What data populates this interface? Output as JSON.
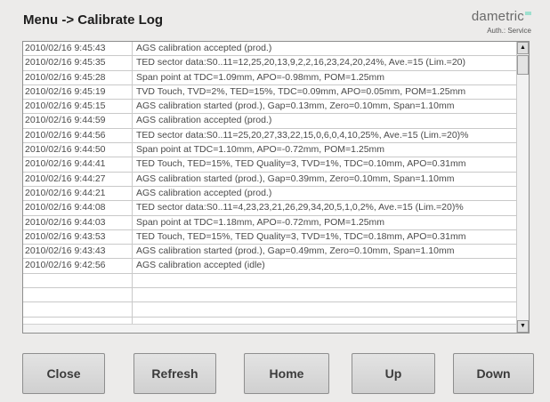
{
  "header": {
    "title": "Menu -> Calibrate Log",
    "brand": "dametric",
    "auth": "Auth.: Service"
  },
  "log": {
    "rows": [
      {
        "time": "2010/02/16 9:45:43",
        "message": "AGS calibration accepted (prod.)"
      },
      {
        "time": "2010/02/16 9:45:35",
        "message": "TED sector data:S0..11=12,25,20,13,9,2,2,16,23,24,20,24%, Ave.=15 (Lim.=20)"
      },
      {
        "time": "2010/02/16 9:45:28",
        "message": "Span point at TDC=1.09mm, APO=-0.98mm, POM=1.25mm"
      },
      {
        "time": "2010/02/16 9:45:19",
        "message": "TVD Touch, TVD=2%, TED=15%, TDC=0.09mm, APO=0.05mm, POM=1.25mm"
      },
      {
        "time": "2010/02/16 9:45:15",
        "message": "AGS calibration started (prod.), Gap=0.13mm, Zero=0.10mm, Span=1.10mm"
      },
      {
        "time": "2010/02/16 9:44:59",
        "message": "AGS calibration accepted (prod.)"
      },
      {
        "time": "2010/02/16 9:44:56",
        "message": "TED sector data:S0..11=25,20,27,33,22,15,0,6,0,4,10,25%, Ave.=15 (Lim.=20)%"
      },
      {
        "time": "2010/02/16 9:44:50",
        "message": "Span point at TDC=1.10mm, APO=-0.72mm, POM=1.25mm"
      },
      {
        "time": "2010/02/16 9:44:41",
        "message": "TED Touch, TED=15%, TED Quality=3, TVD=1%, TDC=0.10mm, APO=0.31mm"
      },
      {
        "time": "2010/02/16 9:44:27",
        "message": "AGS calibration started (prod.), Gap=0.39mm, Zero=0.10mm, Span=1.10mm"
      },
      {
        "time": "2010/02/16 9:44:21",
        "message": "AGS calibration accepted (prod.)"
      },
      {
        "time": "2010/02/16 9:44:08",
        "message": "TED sector data:S0..11=4,23,23,21,26,29,34,20,5,1,0,2%, Ave.=15 (Lim.=20)%"
      },
      {
        "time": "2010/02/16 9:44:03",
        "message": "Span point at TDC=1.18mm, APO=-0.72mm, POM=1.25mm"
      },
      {
        "time": "2010/02/16 9:43:53",
        "message": "TED Touch, TED=15%, TED Quality=3, TVD=1%, TDC=0.18mm, APO=0.31mm"
      },
      {
        "time": "2010/02/16 9:43:43",
        "message": "AGS calibration started (prod.), Gap=0.49mm, Zero=0.10mm, Span=1.10mm"
      },
      {
        "time": "2010/02/16 9:42:56",
        "message": "AGS calibration accepted (idle)"
      },
      {
        "time": "",
        "message": ""
      },
      {
        "time": "",
        "message": ""
      },
      {
        "time": "",
        "message": ""
      },
      {
        "time": "",
        "message": ""
      },
      {
        "time": "",
        "message": ""
      }
    ]
  },
  "buttons": {
    "close": "Close",
    "refresh": "Refresh",
    "home": "Home",
    "up": "Up",
    "down": "Down"
  },
  "icons": {
    "scroll_up": "arrow-up-icon",
    "scroll_down": "arrow-down-icon"
  },
  "colors": {
    "brand_accent": "#9ee0cf"
  }
}
